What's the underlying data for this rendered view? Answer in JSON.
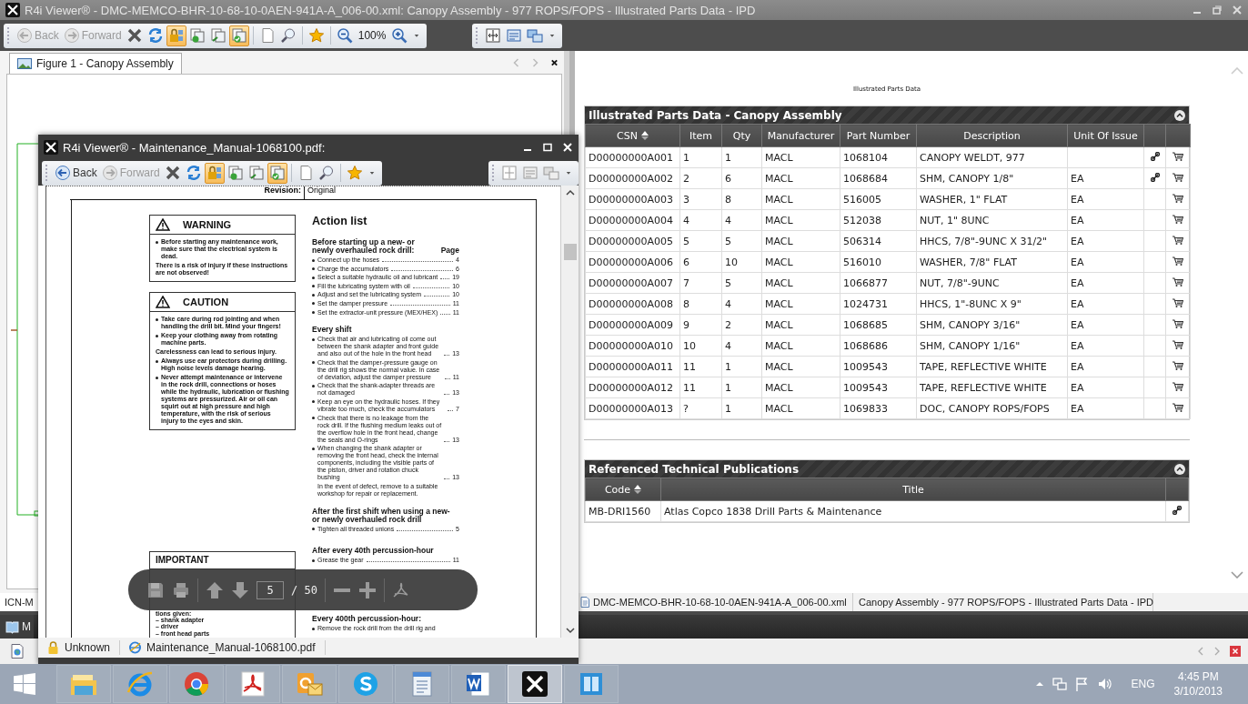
{
  "main_window": {
    "title": "R4i Viewer® - DMC-MEMCO-BHR-10-68-10-0AEN-941A-A_006-00.xml: Canopy Assembly - 977 ROPS/FOPS - Illustrated Parts Data - IPD",
    "toolbars": [
      {
        "items": [
          {
            "kind": "back",
            "label": "Back",
            "disabled": true
          },
          {
            "kind": "forward",
            "label": "Forward",
            "disabled": true
          },
          {
            "kind": "stop",
            "on": false
          },
          {
            "kind": "refresh",
            "on": false
          },
          {
            "kind": "lock",
            "on": true
          },
          {
            "kind": "pages",
            "on": false
          },
          {
            "kind": "pages2",
            "on": false
          },
          {
            "kind": "check",
            "on": true
          },
          {
            "kind": "page",
            "on": false
          },
          {
            "kind": "search",
            "on": false
          },
          {
            "kind": "star",
            "on": false
          },
          {
            "kind": "zoom_out",
            "on": false
          },
          {
            "kind": "zoom_level",
            "label": "100%"
          },
          {
            "kind": "zoom_in",
            "on": false
          },
          {
            "kind": "dropdown"
          }
        ]
      },
      {
        "items": [
          {
            "kind": "fit",
            "on": false
          },
          {
            "kind": "layout",
            "on": false
          },
          {
            "kind": "layout2",
            "on": false
          },
          {
            "kind": "dropdown"
          }
        ]
      }
    ],
    "figure_tab": {
      "label": "Figure 1 - Canopy Assembly",
      "selected": true
    },
    "left_status": "ICN-M",
    "dock_tab": "M",
    "ipd": {
      "heading": "Illustrated Parts Data",
      "parts": {
        "title": "Illustrated Parts Data - Canopy Assembly",
        "columns": [
          {
            "label": "CSN",
            "sorted": true
          },
          {
            "label": "Item",
            "sorted": false
          },
          {
            "label": "Qty",
            "sorted": false
          },
          {
            "label": "Manufacturer",
            "sorted": false
          },
          {
            "label": "Part Number",
            "sorted": false
          },
          {
            "label": "Description",
            "sorted": false
          },
          {
            "label": "Unit Of Issue",
            "sorted": false
          }
        ],
        "rows": [
          {
            "csn": "D00000000A001",
            "item": "1",
            "qty": "1",
            "manufacturer": "MACL",
            "part_number": "1068104",
            "description": "CANOPY WELDT, 977",
            "unit": "",
            "linked": true
          },
          {
            "csn": "D00000000A002",
            "item": "2",
            "qty": "6",
            "manufacturer": "MACL",
            "part_number": "1068684",
            "description": "SHM, CANOPY 1/8\"",
            "unit": "EA",
            "linked": true
          },
          {
            "csn": "D00000000A003",
            "item": "3",
            "qty": "8",
            "manufacturer": "MACL",
            "part_number": "516005",
            "description": "WASHER, 1\" FLAT",
            "unit": "EA",
            "linked": false
          },
          {
            "csn": "D00000000A004",
            "item": "4",
            "qty": "4",
            "manufacturer": "MACL",
            "part_number": "512038",
            "description": "NUT, 1\" 8UNC",
            "unit": "EA",
            "linked": false
          },
          {
            "csn": "D00000000A005",
            "item": "5",
            "qty": "5",
            "manufacturer": "MACL",
            "part_number": "506314",
            "description": "HHCS, 7/8\"-9UNC X 31/2\"",
            "unit": "EA",
            "linked": false
          },
          {
            "csn": "D00000000A006",
            "item": "6",
            "qty": "10",
            "manufacturer": "MACL",
            "part_number": "516010",
            "description": "WASHER, 7/8\" FLAT",
            "unit": "EA",
            "linked": false
          },
          {
            "csn": "D00000000A007",
            "item": "7",
            "qty": "5",
            "manufacturer": "MACL",
            "part_number": "1066877",
            "description": "NUT, 7/8\"-9UNC",
            "unit": "EA",
            "linked": false
          },
          {
            "csn": "D00000000A008",
            "item": "8",
            "qty": "4",
            "manufacturer": "MACL",
            "part_number": "1024731",
            "description": "HHCS, 1\"-8UNC X 9\"",
            "unit": "EA",
            "linked": false
          },
          {
            "csn": "D00000000A009",
            "item": "9",
            "qty": "2",
            "manufacturer": "MACL",
            "part_number": "1068685",
            "description": "SHM, CANOPY 3/16\"",
            "unit": "EA",
            "linked": false
          },
          {
            "csn": "D00000000A010",
            "item": "10",
            "qty": "4",
            "manufacturer": "MACL",
            "part_number": "1068686",
            "description": "SHM, CANOPY 1/16\"",
            "unit": "EA",
            "linked": false
          },
          {
            "csn": "D00000000A011",
            "item": "11",
            "qty": "1",
            "manufacturer": "MACL",
            "part_number": "1009543",
            "description": "TAPE, REFLECTIVE WHITE",
            "unit": "EA",
            "linked": false
          },
          {
            "csn": "D00000000A012",
            "item": "11",
            "qty": "1",
            "manufacturer": "MACL",
            "part_number": "1009543",
            "description": "TAPE, REFLECTIVE WHITE",
            "unit": "EA",
            "linked": false
          },
          {
            "csn": "D00000000A013",
            "item": "?",
            "qty": "1",
            "manufacturer": "MACL",
            "part_number": "1069833",
            "description": "DOC, CANOPY ROPS/FOPS",
            "unit": "EA",
            "linked": false
          }
        ]
      },
      "publications": {
        "title": "Referenced Technical Publications",
        "columns": [
          {
            "label": "Code",
            "sorted": true
          },
          {
            "label": "Title",
            "sorted": false
          }
        ],
        "rows": [
          {
            "code": "MB-DRI1560",
            "title": "Atlas Copco 1838 Drill Parts & Maintenance",
            "linked": true
          }
        ]
      }
    },
    "status_bar": {
      "file": "DMC-MEMCO-BHR-10-68-10-0AEN-941A-A_006-00.xml",
      "title": "Canopy Assembly - 977 ROPS/FOPS - Illustrated Parts Data - IPD"
    }
  },
  "pdf_window": {
    "title": "R4i Viewer® - Maintenance_Manual-1068100.pdf:",
    "toolbars": [
      {
        "items": [
          {
            "kind": "back",
            "label": "Back",
            "disabled": false
          },
          {
            "kind": "forward",
            "label": "Forward",
            "disabled": true
          },
          {
            "kind": "stop",
            "on": false
          },
          {
            "kind": "refresh",
            "on": false
          },
          {
            "kind": "lock",
            "on": true
          },
          {
            "kind": "pages",
            "on": false
          },
          {
            "kind": "pages2",
            "on": false
          },
          {
            "kind": "check",
            "on": true
          },
          {
            "kind": "page",
            "on": false
          },
          {
            "kind": "search",
            "on": false
          },
          {
            "kind": "star",
            "on": false
          },
          {
            "kind": "dropdown"
          }
        ]
      },
      {
        "items": [
          {
            "kind": "fit",
            "on": false
          },
          {
            "kind": "layout",
            "on": false
          },
          {
            "kind": "layout2",
            "on": false
          },
          {
            "kind": "dropdown"
          }
        ]
      }
    ],
    "page": {
      "revision_label": "Revision:",
      "revision_value": "Original",
      "boxes": [
        {
          "title": "WARNING",
          "items": [
            {
              "kind": "bullet",
              "text": "Before starting any maintenance work, make sure that the electrical system is dead."
            },
            {
              "kind": "note",
              "text": "There is a risk of injury if these instructions are not observed!"
            }
          ]
        },
        {
          "title": "CAUTION",
          "items": [
            {
              "kind": "bullet",
              "text": "Take care during rod jointing and when handling the drill bit. Mind your fingers!"
            },
            {
              "kind": "bullet",
              "text": "Keep your clothing away from rotating machine parts."
            },
            {
              "kind": "note",
              "text": "Carelessness can lead to serious injury."
            },
            {
              "kind": "bullet",
              "text": "Always use ear protectors during drilling. High noise levels damage hearing."
            },
            {
              "kind": "bullet",
              "text": "Never attempt maintenance or intervene in the rock drill, connections or hoses while the hydraulic, lubrication or flushing systems are pressurized. Air or oil can squirt out at high pressure and high temperature, with the risk of serious injury to the eyes and skin."
            }
          ]
        }
      ],
      "important": {
        "title": "IMPORTANT",
        "lines": [
          "tions given:",
          "– shank adapter",
          "– driver",
          "– front head parts"
        ]
      },
      "action_list": {
        "title": "Action list",
        "page_label": "Page",
        "sections": [
          {
            "heading": "Before starting up a new- or newly overhauled rock drill:",
            "items": [
              {
                "text": "Connect up the hoses",
                "page": "4"
              },
              {
                "text": "Charge the accumulators",
                "page": "6"
              },
              {
                "text": "Select a suitable hydraulic oil and lubricant",
                "page": "19"
              },
              {
                "text": "Fill the lubricating system with oil",
                "page": "10"
              },
              {
                "text": "Adjust and set the lubricating system",
                "page": "10"
              },
              {
                "text": "Set the damper pressure",
                "page": "11"
              },
              {
                "text": "Set the extractor-unit pressure (MEX/HEX)",
                "page": "11"
              }
            ]
          },
          {
            "heading": "Every shift",
            "items": [
              {
                "text": "Check that air and lubricating oil come out between the shank adapter and front guide and also out of the hole in the front head",
                "page": "13"
              },
              {
                "text": "Check that the damper-pressure gauge on the drill rig shows the normal value. In case of deviation, adjust the damper pressure",
                "page": "11"
              },
              {
                "text": "Check that the shank-adapter threads are not damaged",
                "page": "13"
              },
              {
                "text": "Keep an eye on the hydraulic hoses. If they vibrate too much, check the accumulators",
                "page": "7"
              },
              {
                "text": "Check that there is no leakage from the rock drill. If the flushing medium leaks out of the overflow hole in the front head, change the seals and O-rings",
                "page": "13"
              },
              {
                "text": "When changing the shank adapter or removing the front head, check the internal components, including the visible parts of the piston, driver and rotation chuck bushing",
                "page": "13",
                "note": "In the event of defect, remove to a suitable workshop for repair or replacement."
              }
            ]
          },
          {
            "heading": "After the first shift when using a new- or newly overhauled rock drill",
            "items": [
              {
                "text": "Tighten all threaded unions",
                "page": "5"
              }
            ]
          },
          {
            "heading": "After every 40th percussion-hour",
            "items": [
              {
                "text": "Grease the gear",
                "page": "11"
              }
            ]
          }
        ],
        "after_bar": {
          "heading": "Every 400th percussion-hour:",
          "line": "Remove the rock drill from the drill rig and"
        }
      }
    },
    "viewer_bar": {
      "page": "5",
      "page_count": "/ 50"
    },
    "status": {
      "security": "Unknown",
      "file": "Maintenance_Manual-1068100.pdf"
    }
  },
  "taskbar": {
    "apps": [
      {
        "kind": "explorer",
        "selected": false
      },
      {
        "kind": "ie",
        "selected": false
      },
      {
        "kind": "chrome",
        "selected": false
      },
      {
        "kind": "acrobat",
        "selected": false
      },
      {
        "kind": "outlook",
        "selected": false
      },
      {
        "kind": "skype",
        "selected": false
      },
      {
        "kind": "wordpad",
        "selected": false
      },
      {
        "kind": "word",
        "selected": false
      },
      {
        "kind": "r4i",
        "selected": true
      },
      {
        "kind": "reader",
        "selected": false
      }
    ],
    "language": "ENG",
    "time": "4:45 PM",
    "date": "3/10/2013"
  }
}
